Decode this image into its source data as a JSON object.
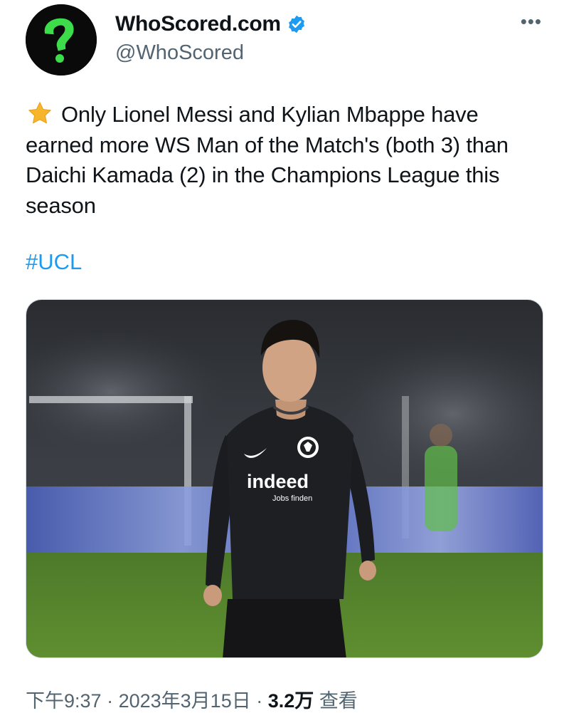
{
  "account": {
    "display_name": "WhoScored.com",
    "handle": "@WhoScored",
    "verified": true,
    "avatar_icon": "green-question-mark-logo"
  },
  "more_icon": "more-options-icon",
  "more_glyph": "•••",
  "tweet": {
    "emoji": "star-emoji",
    "text": "Only Lionel Messi and Kylian Mbappe have earned more WS Man of the Match's (both 3) than Daichi Kamada (2) in the Champions League this season",
    "hashtag": "#UCL"
  },
  "media": {
    "jersey_sponsor": "indeed",
    "jersey_sponsor_sub": "Jobs finden"
  },
  "meta": {
    "time": "下午9:37",
    "date": "2023年3月15日",
    "views": "3.2万",
    "views_label": "查看",
    "separator": "·"
  },
  "colors": {
    "accent": "#1d9bf0",
    "text": "#0f1419",
    "secondary": "#536471",
    "logo_green": "#3ddc4a"
  }
}
